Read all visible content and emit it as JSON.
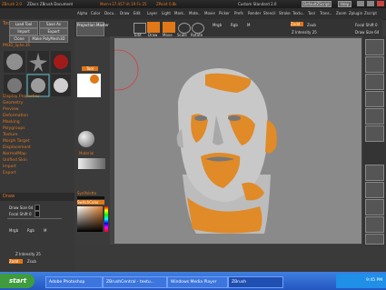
{
  "titlebar": {
    "app": "ZBrush 2.0",
    "doc": "ZDocs ZBrush Document",
    "mem": "Mem+37.457 Ut 19 Fv 25",
    "pt": "ZPoint 0.8k",
    "custom": "Custom Standard 2.0",
    "default_script": "DefaultZScript",
    "help": "Help"
  },
  "menu": [
    "Alpha",
    "Color",
    "Docu..",
    "Draw",
    "Edit",
    "Layer",
    "Light",
    "Mark..",
    "Mate..",
    "Movie",
    "Picker",
    "Prefs",
    "Render",
    "Stencil",
    "Stroke",
    "Textu..",
    "Tool",
    "Trans..",
    "Zoom",
    "Zplugin",
    "Zscript"
  ],
  "left": {
    "load_tool": "Load Tool",
    "save_as": "Save As",
    "import": "Import",
    "export": "Export",
    "clone": "Clone",
    "make_polymesh": "Make PolyMesh3D",
    "pm3d": "PM3D_Sphe.36",
    "sections": [
      "Display Properties",
      "Geometry",
      "Preview",
      "Deformation",
      "Masking",
      "Polygroups",
      "Texture",
      "Morph Target",
      "Displacement",
      "NormalMap",
      "Unified Skin",
      "Import",
      "Export"
    ],
    "draw_title": "Draw",
    "draw_size": "Draw Size 64",
    "focal_shift": "Focal Shift 0",
    "mrgb": "Mrgb",
    "rgb": "Rgb",
    "m": "M",
    "zintensity": "Z Intensity 25",
    "zadd": "Zadd",
    "zsub": "Zsub"
  },
  "mid": {
    "projection": "Projection Master",
    "tool_label": "Tool",
    "material_label": "Material",
    "synth_label": "SynPalette",
    "switchcolor": "SwitchColor"
  },
  "toolbar": {
    "labels": [
      "Edit",
      "Draw",
      "Move",
      "Scale",
      "Rotate"
    ],
    "mrgb": "Mrgb",
    "rgb": "Rgb",
    "m": "M",
    "zadd": "Zadd",
    "zsub": "Zsub",
    "zint": "Z Intensity 25",
    "focal": "Focal Shift 0",
    "drawsize": "Draw Size 64"
  },
  "taskbar": {
    "start": "start",
    "tasks": [
      "Adobe Photoshop",
      "ZBrushCentral - textu...",
      "Windows Media Player",
      "ZBrush"
    ],
    "clock": "9:45 PM"
  }
}
